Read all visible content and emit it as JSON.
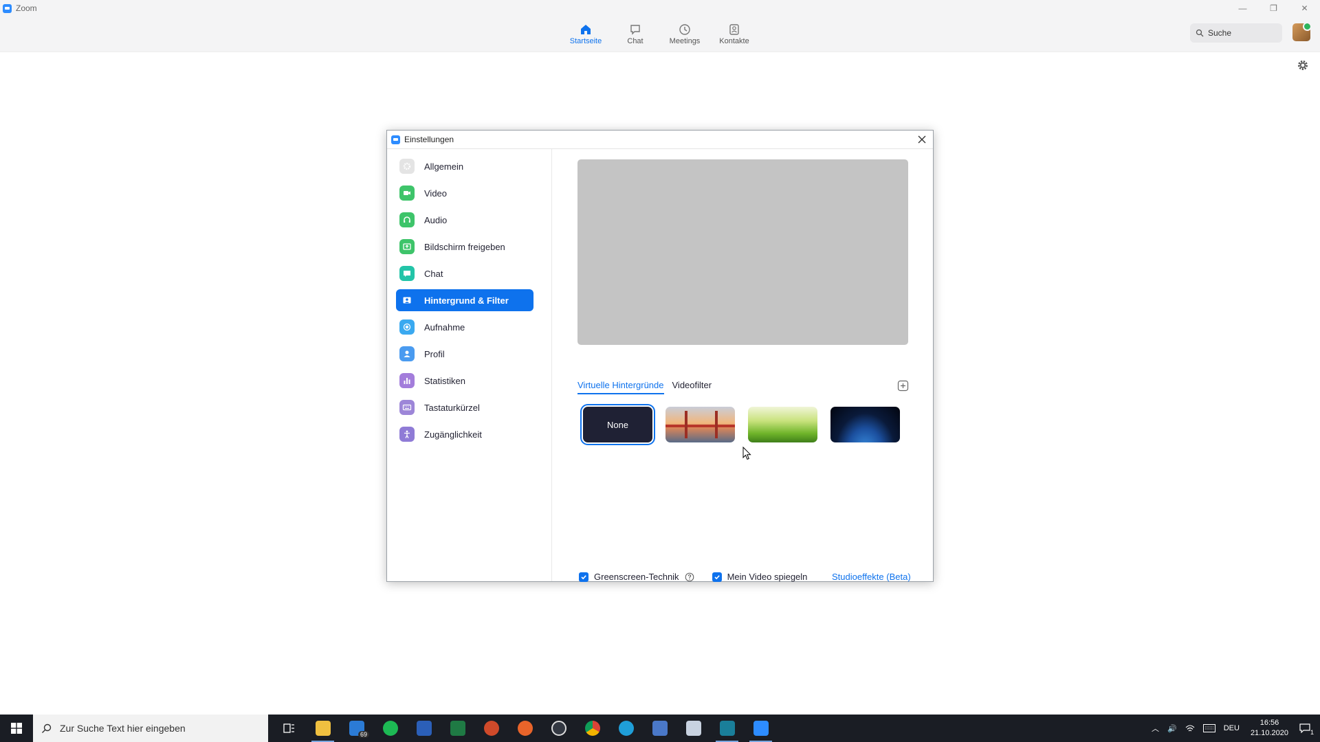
{
  "window": {
    "title": "Zoom",
    "minimize": "—",
    "restore": "❐",
    "close": "✕"
  },
  "nav": {
    "tabs": [
      {
        "label": "Startseite",
        "icon": "home-icon",
        "active": true
      },
      {
        "label": "Chat",
        "icon": "chat-icon",
        "active": false
      },
      {
        "label": "Meetings",
        "icon": "clock-icon",
        "active": false
      },
      {
        "label": "Kontakte",
        "icon": "contact-icon",
        "active": false
      }
    ],
    "search_label": "Suche"
  },
  "settings": {
    "title": "Einstellungen",
    "sidebar": [
      {
        "label": "Allgemein",
        "icon": "gear-icon",
        "color": "#d6d6d6"
      },
      {
        "label": "Video",
        "icon": "video-icon",
        "color": "#3ec46a"
      },
      {
        "label": "Audio",
        "icon": "headphones-icon",
        "color": "#3ec46a"
      },
      {
        "label": "Bildschirm freigeben",
        "icon": "share-screen-icon",
        "color": "#3ec46a"
      },
      {
        "label": "Chat",
        "icon": "chat-icon",
        "color": "#23c4a8"
      },
      {
        "label": "Hintergrund & Filter",
        "icon": "background-icon",
        "color": "#0e72ed",
        "active": true
      },
      {
        "label": "Aufnahme",
        "icon": "record-icon",
        "color": "#3aa9f0"
      },
      {
        "label": "Profil",
        "icon": "profile-icon",
        "color": "#4a9bf0"
      },
      {
        "label": "Statistiken",
        "icon": "stats-icon",
        "color": "#a37ddb"
      },
      {
        "label": "Tastaturkürzel",
        "icon": "keyboard-icon",
        "color": "#9d86d8"
      },
      {
        "label": "Zugänglichkeit",
        "icon": "accessibility-icon",
        "color": "#8f7bd6"
      }
    ],
    "tabs": [
      {
        "label": "Virtuelle Hintergründe",
        "active": true
      },
      {
        "label": "Videofilter",
        "active": false
      }
    ],
    "backgrounds": [
      {
        "label": "None",
        "kind": "none",
        "selected": true
      },
      {
        "label": "",
        "kind": "bridge",
        "selected": false
      },
      {
        "label": "",
        "kind": "grass",
        "selected": false
      },
      {
        "label": "",
        "kind": "space",
        "selected": false
      }
    ],
    "options": {
      "greenscreen_label": "Greenscreen-Technik",
      "greenscreen_checked": true,
      "mirror_label": "Mein Video spiegeln",
      "mirror_checked": true,
      "studio_link": "Studioeffekte (Beta)"
    }
  },
  "taskbar": {
    "search_placeholder": "Zur Suche Text hier eingeben",
    "apps": [
      {
        "name": "task-view",
        "color": "#1a1d24",
        "running": false
      },
      {
        "name": "file-explorer",
        "color": "#f0c040",
        "running": true
      },
      {
        "name": "mail",
        "color": "#2b7bd6",
        "running": false,
        "badge": "69"
      },
      {
        "name": "spotify",
        "color": "#1db954",
        "running": false
      },
      {
        "name": "word",
        "color": "#2b5fb8",
        "running": false
      },
      {
        "name": "excel",
        "color": "#1f7a44",
        "running": false
      },
      {
        "name": "powerpoint",
        "color": "#d04a2a",
        "running": false
      },
      {
        "name": "app-orange",
        "color": "#e8642a",
        "running": false
      },
      {
        "name": "obs",
        "color": "#333842",
        "running": false
      },
      {
        "name": "chrome",
        "color": "#e3a21a",
        "running": false
      },
      {
        "name": "edge",
        "color": "#1f9ed8",
        "running": false
      },
      {
        "name": "app-doc",
        "color": "#4a78c8",
        "running": false
      },
      {
        "name": "app-window",
        "color": "#c8d2e0",
        "running": false
      },
      {
        "name": "app-teal",
        "color": "#1a7f9a",
        "running": true
      },
      {
        "name": "zoom",
        "color": "#2d8cff",
        "running": true
      }
    ],
    "tray": {
      "language": "DEU",
      "time": "16:56",
      "date": "21.10.2020",
      "notifications": "1"
    }
  }
}
